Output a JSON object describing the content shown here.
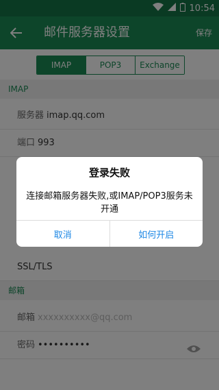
{
  "status_bar": {
    "time": "10:54"
  },
  "app_bar": {
    "title": "邮件服务器设置",
    "save_label": "保存"
  },
  "protocol_tabs": [
    {
      "label": "IMAP",
      "active": true
    },
    {
      "label": "POP3",
      "active": false
    },
    {
      "label": "Exchange",
      "active": false
    }
  ],
  "imap_section": {
    "header": "IMAP",
    "server_label": "服务器",
    "server_value": "imap.qq.com",
    "port_label": "端口",
    "port_value": "993"
  },
  "security": {
    "value": "SSL/TLS"
  },
  "mailbox_section": {
    "header": "邮箱",
    "email_label": "邮箱",
    "email_placeholder": "xxxxxxxxxx@qq.com",
    "password_label": "密码",
    "password_value": "••••••••••"
  },
  "dialog": {
    "title": "登录失败",
    "message": "连接邮箱服务器失败,或IMAP/POP3服务未开通",
    "cancel_label": "取消",
    "confirm_label": "如何开启"
  },
  "colors": {
    "primary": "#1b8a55",
    "dialog_button": "#1e88e5"
  }
}
